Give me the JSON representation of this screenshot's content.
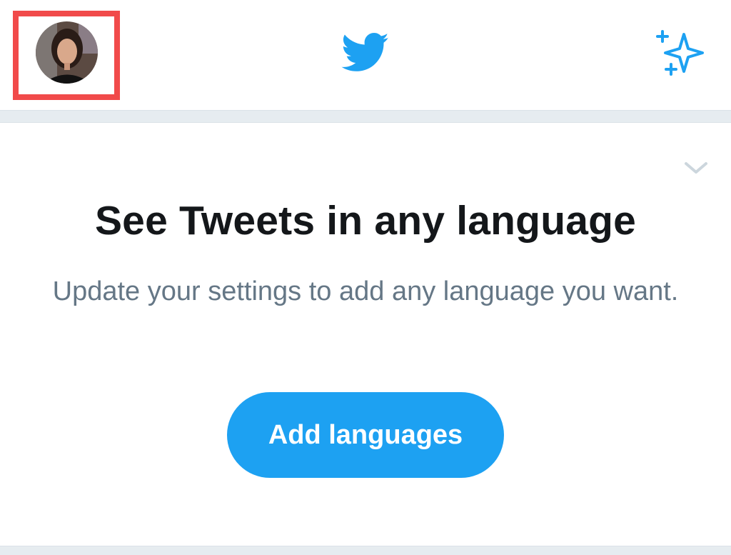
{
  "header": {
    "avatar_icon": "profile-photo",
    "logo_icon": "twitter-bird-logo",
    "sparkle_icon": "sparkle-stars-icon",
    "highlight_color": "#f14a4a",
    "brand_color": "#1da1f2"
  },
  "prompt": {
    "dismiss_icon": "chevron-down-icon",
    "title": "See Tweets in any language",
    "subtitle": "Update your settings to add any language you want.",
    "button_label": "Add languages"
  }
}
